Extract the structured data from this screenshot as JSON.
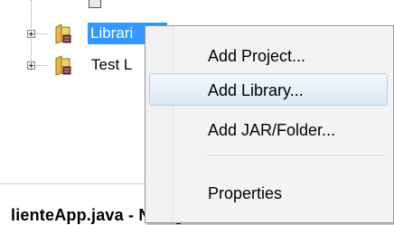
{
  "tree": {
    "nodes": [
      {
        "label": "Librari",
        "selected": true,
        "icon": "library-folder-icon"
      },
      {
        "label": "Test L",
        "selected": false,
        "icon": "library-folder-icon"
      }
    ]
  },
  "editor_tab": {
    "label": "lienteApp.java - Navigat"
  },
  "context_menu": {
    "items": [
      {
        "label": "Add Project..."
      },
      {
        "label": "Add Library...",
        "hovered": true
      },
      {
        "label": "Add JAR/Folder..."
      },
      {
        "label": "Properties"
      }
    ]
  },
  "colors": {
    "selection": "#3399ff",
    "menu_background": "#f3f3f3",
    "hover_border": "#a8d8eb"
  }
}
